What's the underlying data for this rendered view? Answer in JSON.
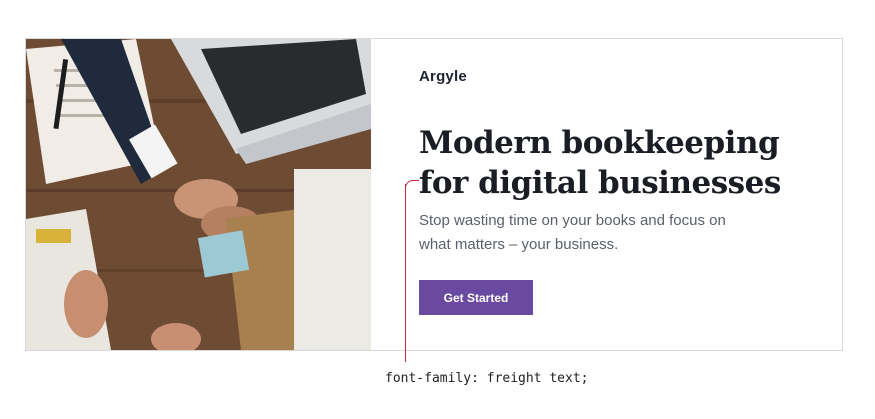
{
  "hero": {
    "brand": "Argyle",
    "headline_line1": "Modern bookkeeping",
    "headline_line2": "for digital businesses",
    "subtext": "Stop wasting time on your books and focus on what matters – your business.",
    "cta_label": "Get Started",
    "accent_color": "#6a4aa0",
    "photo_description_icon": "business-handshake-photo"
  },
  "annotation": {
    "caption": "font-family: freight text;",
    "line_color": "#c8283c"
  }
}
